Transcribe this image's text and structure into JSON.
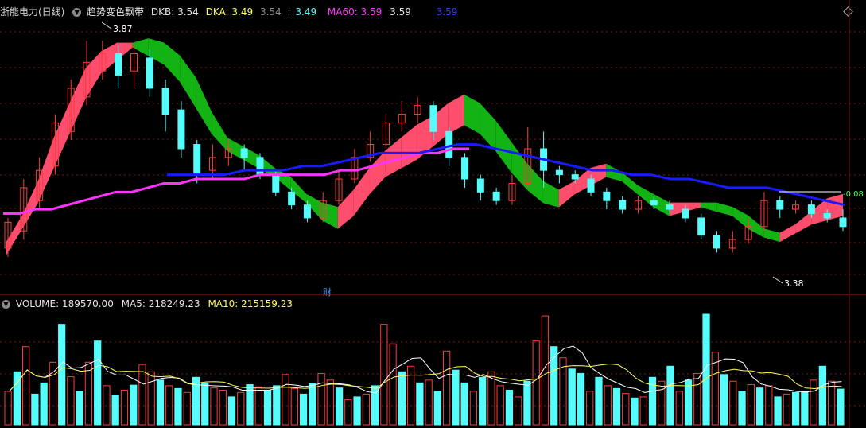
{
  "header": {
    "stock_name": "浙能电力(日线)",
    "indicator_name": "趋势变色飘带",
    "dkb_label": "DKB: 3.54",
    "dka_label": "DKA: 3.49",
    "val_a": "3.54",
    "val_b": "3.49",
    "ma60_label": "MA60: 3.59",
    "ma60_val": "3.59",
    "blue_val": "3.59"
  },
  "volume_header": {
    "volume_label": "VOLUME: 189570.00",
    "ma5_label": "MA5: 218249.23",
    "ma10_label": "MA10: 215159.23"
  },
  "annotations": {
    "high_label": "3.87",
    "low_label": "3.38",
    "right_label": "-0.08",
    "finance_marker": "财"
  },
  "colors": {
    "up": "#ff3b3b",
    "down": "#54fcfc",
    "ribbon_up": "#ff4d6d",
    "ribbon_down": "#12b312",
    "ma60": "#ff33ff",
    "blue_line": "#1a1aff",
    "ma5": "#ffffff",
    "ma10": "#ffff55",
    "grid": "#7a1414"
  },
  "chart_data": {
    "type": "candlestick",
    "price_range": [
      3.32,
      3.92
    ],
    "ribbon": [
      [
        3.38,
        3.4
      ],
      [
        3.44,
        3.46
      ],
      [
        3.5,
        3.54
      ],
      [
        3.58,
        3.64
      ],
      [
        3.66,
        3.72
      ],
      [
        3.74,
        3.8
      ],
      [
        3.8,
        3.84
      ],
      [
        3.83,
        3.86
      ],
      [
        3.86,
        3.86
      ],
      [
        3.84,
        3.87
      ],
      [
        3.82,
        3.86
      ],
      [
        3.78,
        3.83
      ],
      [
        3.72,
        3.78
      ],
      [
        3.66,
        3.7
      ],
      [
        3.62,
        3.64
      ],
      [
        3.6,
        3.62
      ],
      [
        3.58,
        3.6
      ],
      [
        3.56,
        3.57
      ],
      [
        3.53,
        3.55
      ],
      [
        3.5,
        3.51
      ],
      [
        3.46,
        3.49
      ],
      [
        3.44,
        3.48
      ],
      [
        3.47,
        3.52
      ],
      [
        3.52,
        3.57
      ],
      [
        3.56,
        3.61
      ],
      [
        3.58,
        3.64
      ],
      [
        3.6,
        3.67
      ],
      [
        3.63,
        3.69
      ],
      [
        3.66,
        3.72
      ],
      [
        3.68,
        3.74
      ],
      [
        3.66,
        3.72
      ],
      [
        3.62,
        3.68
      ],
      [
        3.57,
        3.63
      ],
      [
        3.53,
        3.58
      ],
      [
        3.5,
        3.54
      ],
      [
        3.49,
        3.52
      ],
      [
        3.52,
        3.54
      ],
      [
        3.54,
        3.57
      ],
      [
        3.56,
        3.58
      ],
      [
        3.55,
        3.56
      ],
      [
        3.52,
        3.53
      ],
      [
        3.49,
        3.51
      ],
      [
        3.47,
        3.49
      ],
      [
        3.48,
        3.49
      ],
      [
        3.49,
        3.49
      ],
      [
        3.48,
        3.49
      ],
      [
        3.47,
        3.48
      ],
      [
        3.44,
        3.46
      ],
      [
        3.42,
        3.43
      ],
      [
        3.41,
        3.42
      ],
      [
        3.43,
        3.44
      ],
      [
        3.45,
        3.47
      ],
      [
        3.46,
        3.5
      ],
      [
        3.47,
        3.51
      ]
    ],
    "ohlc": [
      [
        3.39,
        3.45,
        3.37,
        3.46
      ],
      [
        3.43,
        3.53,
        3.41,
        3.55
      ],
      [
        3.5,
        3.57,
        3.48,
        3.6
      ],
      [
        3.58,
        3.68,
        3.56,
        3.7
      ],
      [
        3.66,
        3.76,
        3.64,
        3.78
      ],
      [
        3.74,
        3.82,
        3.72,
        3.87
      ],
      [
        3.8,
        3.84,
        3.78,
        3.87
      ],
      [
        3.84,
        3.79,
        3.76,
        3.86
      ],
      [
        3.8,
        3.84,
        3.76,
        3.86
      ],
      [
        3.83,
        3.76,
        3.74,
        3.85
      ],
      [
        3.76,
        3.7,
        3.66,
        3.78
      ],
      [
        3.71,
        3.62,
        3.6,
        3.73
      ],
      [
        3.63,
        3.56,
        3.54,
        3.64
      ],
      [
        3.57,
        3.6,
        3.55,
        3.63
      ],
      [
        3.6,
        3.62,
        3.58,
        3.64
      ],
      [
        3.62,
        3.6,
        3.57,
        3.63
      ],
      [
        3.6,
        3.56,
        3.55,
        3.61
      ],
      [
        3.56,
        3.52,
        3.51,
        3.57
      ],
      [
        3.52,
        3.49,
        3.48,
        3.53
      ],
      [
        3.49,
        3.46,
        3.45,
        3.5
      ],
      [
        3.46,
        3.5,
        3.45,
        3.52
      ],
      [
        3.5,
        3.55,
        3.49,
        3.57
      ],
      [
        3.55,
        3.6,
        3.54,
        3.62
      ],
      [
        3.6,
        3.63,
        3.59,
        3.66
      ],
      [
        3.63,
        3.68,
        3.62,
        3.7
      ],
      [
        3.68,
        3.7,
        3.66,
        3.73
      ],
      [
        3.7,
        3.72,
        3.68,
        3.74
      ],
      [
        3.72,
        3.66,
        3.64,
        3.73
      ],
      [
        3.66,
        3.6,
        3.58,
        3.67
      ],
      [
        3.6,
        3.55,
        3.53,
        3.61
      ],
      [
        3.55,
        3.52,
        3.5,
        3.56
      ],
      [
        3.52,
        3.5,
        3.49,
        3.53
      ],
      [
        3.5,
        3.54,
        3.49,
        3.56
      ],
      [
        3.54,
        3.62,
        3.53,
        3.67
      ],
      [
        3.62,
        3.57,
        3.53,
        3.66
      ],
      [
        3.57,
        3.56,
        3.54,
        3.58
      ],
      [
        3.56,
        3.55,
        3.54,
        3.57
      ],
      [
        3.55,
        3.52,
        3.51,
        3.56
      ],
      [
        3.52,
        3.5,
        3.48,
        3.53
      ],
      [
        3.5,
        3.48,
        3.47,
        3.51
      ],
      [
        3.48,
        3.5,
        3.47,
        3.51
      ],
      [
        3.5,
        3.49,
        3.48,
        3.51
      ],
      [
        3.49,
        3.48,
        3.47,
        3.5
      ],
      [
        3.48,
        3.46,
        3.45,
        3.49
      ],
      [
        3.46,
        3.42,
        3.41,
        3.47
      ],
      [
        3.42,
        3.39,
        3.38,
        3.43
      ],
      [
        3.39,
        3.41,
        3.38,
        3.43
      ],
      [
        3.41,
        3.44,
        3.4,
        3.46
      ],
      [
        3.44,
        3.5,
        3.43,
        3.52
      ],
      [
        3.5,
        3.48,
        3.46,
        3.51
      ],
      [
        3.48,
        3.49,
        3.47,
        3.5
      ],
      [
        3.49,
        3.47,
        3.46,
        3.5
      ],
      [
        3.47,
        3.46,
        3.45,
        3.48
      ],
      [
        3.46,
        3.44,
        3.43,
        3.48
      ]
    ],
    "ma60": [
      3.47,
      3.47,
      3.48,
      3.48,
      3.49,
      3.5,
      3.51,
      3.52,
      3.52,
      3.53,
      3.54,
      3.54,
      3.55,
      3.55,
      3.55,
      3.55,
      3.56,
      3.56,
      3.56,
      3.56,
      3.56,
      3.57,
      3.57,
      3.58,
      3.59,
      3.6,
      3.61,
      3.61,
      3.62,
      3.62
    ],
    "blue_line": [
      3.56,
      3.56,
      3.56,
      3.56,
      3.57,
      3.57,
      3.57,
      3.58,
      3.58,
      3.59,
      3.6,
      3.61,
      3.61,
      3.61,
      3.62,
      3.63,
      3.63,
      3.62,
      3.61,
      3.6,
      3.59,
      3.58,
      3.57,
      3.57,
      3.56,
      3.56,
      3.55,
      3.55,
      3.54,
      3.53,
      3.53,
      3.53,
      3.52,
      3.51,
      3.5,
      3.49
    ],
    "volume": [
      60,
      95,
      140,
      55,
      75,
      112,
      180,
      86,
      60,
      112,
      150,
      70,
      53,
      62,
      71,
      108,
      95,
      80,
      70,
      65,
      58,
      85,
      75,
      66,
      62,
      50,
      58,
      72,
      68,
      62,
      70,
      90,
      65,
      55,
      74,
      92,
      80,
      66,
      45,
      50,
      55,
      70,
      180,
      145,
      95,
      105,
      75,
      80,
      60,
      132,
      98,
      75,
      60,
      85,
      95,
      70,
      62,
      50,
      78,
      150,
      195,
      140,
      120,
      100,
      92,
      60,
      85,
      70,
      65,
      56,
      48,
      50,
      85,
      78,
      105,
      60,
      80,
      92,
      198,
      130,
      90,
      78,
      60,
      72,
      66,
      70,
      50,
      55,
      58,
      60,
      80,
      105,
      78,
      64
    ],
    "volume_up": [
      1,
      0,
      1,
      0,
      0,
      1,
      0,
      1,
      0,
      1,
      0,
      1,
      0,
      1,
      0,
      1,
      1,
      0,
      1,
      0,
      1,
      0,
      0,
      1,
      1,
      0,
      1,
      0,
      1,
      0,
      0,
      1,
      1,
      0,
      0,
      1,
      1,
      0,
      1,
      0,
      1,
      0,
      1,
      1,
      0,
      1,
      0,
      1,
      0,
      1,
      0,
      0,
      1,
      0,
      1,
      1,
      0,
      1,
      0,
      1,
      1,
      0,
      1,
      0,
      0,
      1,
      0,
      1,
      0,
      1,
      0,
      1,
      0,
      1,
      0,
      1,
      0,
      1,
      0,
      1,
      0,
      1,
      0,
      1,
      0,
      1,
      0,
      1,
      0,
      0,
      1,
      0,
      1,
      0
    ]
  }
}
